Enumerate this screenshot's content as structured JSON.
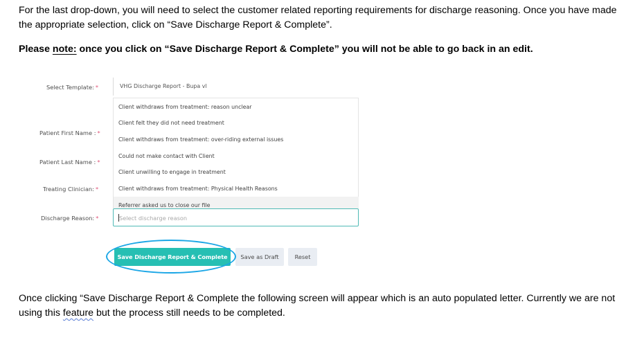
{
  "intro_text": "For the last drop-down, you will need to select the customer related reporting requirements for discharge reasoning. Once you have made the appropriate selection, click on “Save Discharge Report & Complete”.",
  "note": {
    "prefix": "Please ",
    "underlined": "note:",
    "rest": " once you click on “Save Discharge Report & Complete” you will not be able to go back in an edit."
  },
  "form": {
    "labels": {
      "template": "Select Template:",
      "first_name": "Patient First Name :",
      "last_name": "Patient Last Name :",
      "clinician": "Treating Clinician:",
      "discharge_reason": "Discharge Reason:"
    },
    "required_mark": "*",
    "template_value": "VHG Discharge Report - Bupa vl",
    "options": [
      "Client withdraws from treatment: reason unclear",
      "Client felt they did not need treatment",
      "Client withdraws from treatment: over-riding external issues",
      "Could not make contact with Client",
      "Client unwilling to engage in treatment",
      "Client withdraws from treatment: Physical Health Reasons",
      "Referrer asked us to close our file"
    ],
    "reason_placeholder": "Select discharge reason"
  },
  "buttons": {
    "save_complete": "Save Discharge Report & Complete",
    "save_draft": "Save as Draft",
    "reset": "Reset"
  },
  "outro": {
    "part1": "Once clicking “Save Discharge Report & Complete the following screen will appear which is an auto populated letter. Currently we are not using this ",
    "underlined": "feature",
    "part2": " but the process still needs to be completed."
  },
  "colors": {
    "primary_button": "#26bfb3",
    "highlight_ring": "#1aa6e6",
    "required_asterisk": "#e0557a"
  }
}
